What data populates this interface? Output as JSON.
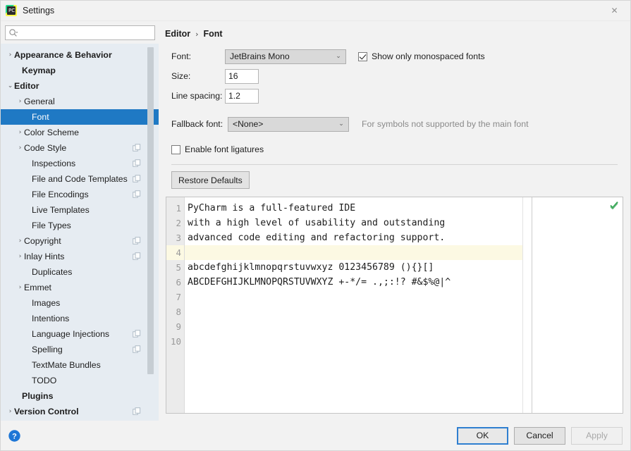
{
  "window": {
    "title": "Settings",
    "app_icon": "pycharm-icon",
    "close_label": "✕"
  },
  "search": {
    "value": "",
    "placeholder": ""
  },
  "sidebar": {
    "scroll_thumb": true,
    "items": [
      {
        "label": "Appearance & Behavior",
        "arrow": "›",
        "bold": true,
        "indent": 8,
        "selected": false,
        "badge": false
      },
      {
        "label": "Keymap",
        "arrow": "",
        "bold": true,
        "indent": 19,
        "selected": false,
        "badge": false
      },
      {
        "label": "Editor",
        "arrow": "⌄",
        "bold": true,
        "indent": 8,
        "selected": false,
        "badge": false
      },
      {
        "label": "General",
        "arrow": "›",
        "bold": false,
        "indent": 22,
        "selected": false,
        "badge": false
      },
      {
        "label": "Font",
        "arrow": "",
        "bold": false,
        "indent": 33,
        "selected": true,
        "badge": false
      },
      {
        "label": "Color Scheme",
        "arrow": "›",
        "bold": false,
        "indent": 22,
        "selected": false,
        "badge": false
      },
      {
        "label": "Code Style",
        "arrow": "›",
        "bold": false,
        "indent": 22,
        "selected": false,
        "badge": true
      },
      {
        "label": "Inspections",
        "arrow": "",
        "bold": false,
        "indent": 33,
        "selected": false,
        "badge": true
      },
      {
        "label": "File and Code Templates",
        "arrow": "",
        "bold": false,
        "indent": 33,
        "selected": false,
        "badge": true
      },
      {
        "label": "File Encodings",
        "arrow": "",
        "bold": false,
        "indent": 33,
        "selected": false,
        "badge": true
      },
      {
        "label": "Live Templates",
        "arrow": "",
        "bold": false,
        "indent": 33,
        "selected": false,
        "badge": false
      },
      {
        "label": "File Types",
        "arrow": "",
        "bold": false,
        "indent": 33,
        "selected": false,
        "badge": false
      },
      {
        "label": "Copyright",
        "arrow": "›",
        "bold": false,
        "indent": 22,
        "selected": false,
        "badge": true
      },
      {
        "label": "Inlay Hints",
        "arrow": "›",
        "bold": false,
        "indent": 22,
        "selected": false,
        "badge": true
      },
      {
        "label": "Duplicates",
        "arrow": "",
        "bold": false,
        "indent": 33,
        "selected": false,
        "badge": false
      },
      {
        "label": "Emmet",
        "arrow": "›",
        "bold": false,
        "indent": 22,
        "selected": false,
        "badge": false
      },
      {
        "label": "Images",
        "arrow": "",
        "bold": false,
        "indent": 33,
        "selected": false,
        "badge": false
      },
      {
        "label": "Intentions",
        "arrow": "",
        "bold": false,
        "indent": 33,
        "selected": false,
        "badge": false
      },
      {
        "label": "Language Injections",
        "arrow": "",
        "bold": false,
        "indent": 33,
        "selected": false,
        "badge": true
      },
      {
        "label": "Spelling",
        "arrow": "",
        "bold": false,
        "indent": 33,
        "selected": false,
        "badge": true
      },
      {
        "label": "TextMate Bundles",
        "arrow": "",
        "bold": false,
        "indent": 33,
        "selected": false,
        "badge": false
      },
      {
        "label": "TODO",
        "arrow": "",
        "bold": false,
        "indent": 33,
        "selected": false,
        "badge": false
      },
      {
        "label": "Plugins",
        "arrow": "",
        "bold": true,
        "indent": 19,
        "selected": false,
        "badge": false
      },
      {
        "label": "Version Control",
        "arrow": "›",
        "bold": true,
        "indent": 8,
        "selected": false,
        "badge": true
      }
    ]
  },
  "breadcrumb": {
    "parent": "Editor",
    "separator": "›",
    "current": "Font"
  },
  "form": {
    "font_label": "Font:",
    "font_value": "JetBrains Mono",
    "monospaced_label": "Show only monospaced fonts",
    "monospaced_checked": true,
    "size_label": "Size:",
    "size_value": "16",
    "line_spacing_label": "Line spacing:",
    "line_spacing_value": "1.2",
    "fallback_label": "Fallback font:",
    "fallback_value": "<None>",
    "fallback_hint": "For symbols not supported by the main font",
    "ligatures_label": "Enable font ligatures",
    "ligatures_checked": false,
    "restore_defaults_label": "Restore Defaults",
    "dropdown_arrow": "⌄"
  },
  "preview": {
    "lines": [
      {
        "num": "1",
        "text": "PyCharm is a full-featured IDE",
        "current": false
      },
      {
        "num": "2",
        "text": "with a high level of usability and outstanding",
        "current": false
      },
      {
        "num": "3",
        "text": "advanced code editing and refactoring support.",
        "current": false
      },
      {
        "num": "4",
        "text": "",
        "current": true
      },
      {
        "num": "5",
        "text": "abcdefghijklmnopqrstuvwxyz 0123456789 (){}[]",
        "current": false
      },
      {
        "num": "6",
        "text": "ABCDEFGHIJKLMNOPQRSTUVWXYZ +-*/= .,;:!? #&$%@|^",
        "current": false
      },
      {
        "num": "7",
        "text": "",
        "current": false
      },
      {
        "num": "8",
        "text": "",
        "current": false
      },
      {
        "num": "9",
        "text": "",
        "current": false
      },
      {
        "num": "10",
        "text": "",
        "current": false
      }
    ],
    "status_icon": "inspection-ok-check-icon"
  },
  "footer": {
    "help_label": "?",
    "ok_label": "OK",
    "cancel_label": "Cancel",
    "apply_label": "Apply",
    "apply_disabled": true
  },
  "colors": {
    "selection_blue": "#1f79c4",
    "sidebar_bg": "#e6ecf2",
    "dialog_bg": "#f2f2f2",
    "caret_row": "#fcf9e3",
    "accent_ok": "#3aa757"
  }
}
